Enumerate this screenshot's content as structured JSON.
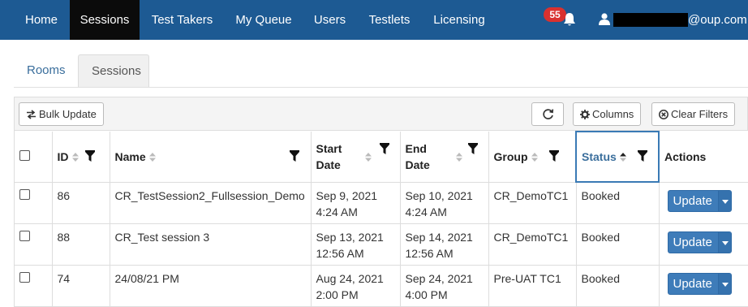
{
  "nav": {
    "items": [
      "Home",
      "Sessions",
      "Test Takers",
      "My Queue",
      "Users",
      "Testlets",
      "Licensing"
    ],
    "active": "Sessions",
    "notification_count": "55",
    "user_email_suffix": "@oup.com",
    "colors": {
      "bar": "#1d5a93",
      "active": "#0b0b0b",
      "badge": "#d9312f"
    }
  },
  "tabs": {
    "rooms": "Rooms",
    "sessions": "Sessions"
  },
  "toolbar": {
    "bulk_update": "Bulk Update",
    "columns": "Columns",
    "clear_filters": "Clear Filters"
  },
  "table": {
    "headers": {
      "id": "ID",
      "name": "Name",
      "start_line1": "Start",
      "start_line2": "Date",
      "end_line1": "End",
      "end_line2": "Date",
      "group": "Group",
      "status": "Status",
      "actions": "Actions"
    },
    "rows": [
      {
        "id": "86",
        "name": "CR_TestSession2_Fullsession_Demo",
        "start_date": "Sep 9, 2021",
        "start_time": "4:24 AM",
        "end_date": "Sep 10, 2021",
        "end_time": "4:24 AM",
        "group": "CR_DemoTC1",
        "status": "Booked",
        "action": "Update"
      },
      {
        "id": "88",
        "name": "CR_Test session 3",
        "start_date": "Sep 13, 2021",
        "start_time": "12:56 AM",
        "end_date": "Sep 14, 2021",
        "end_time": "12:56 AM",
        "group": "CR_DemoTC1",
        "status": "Booked",
        "action": "Update"
      },
      {
        "id": "74",
        "name": "24/08/21 PM",
        "start_date": "Aug 24, 2021",
        "start_time": "2:00 PM",
        "end_date": "Sep 24, 2021",
        "end_time": "4:00 PM",
        "group": "Pre-UAT TC1",
        "status": "Booked",
        "action": "Update"
      }
    ]
  }
}
